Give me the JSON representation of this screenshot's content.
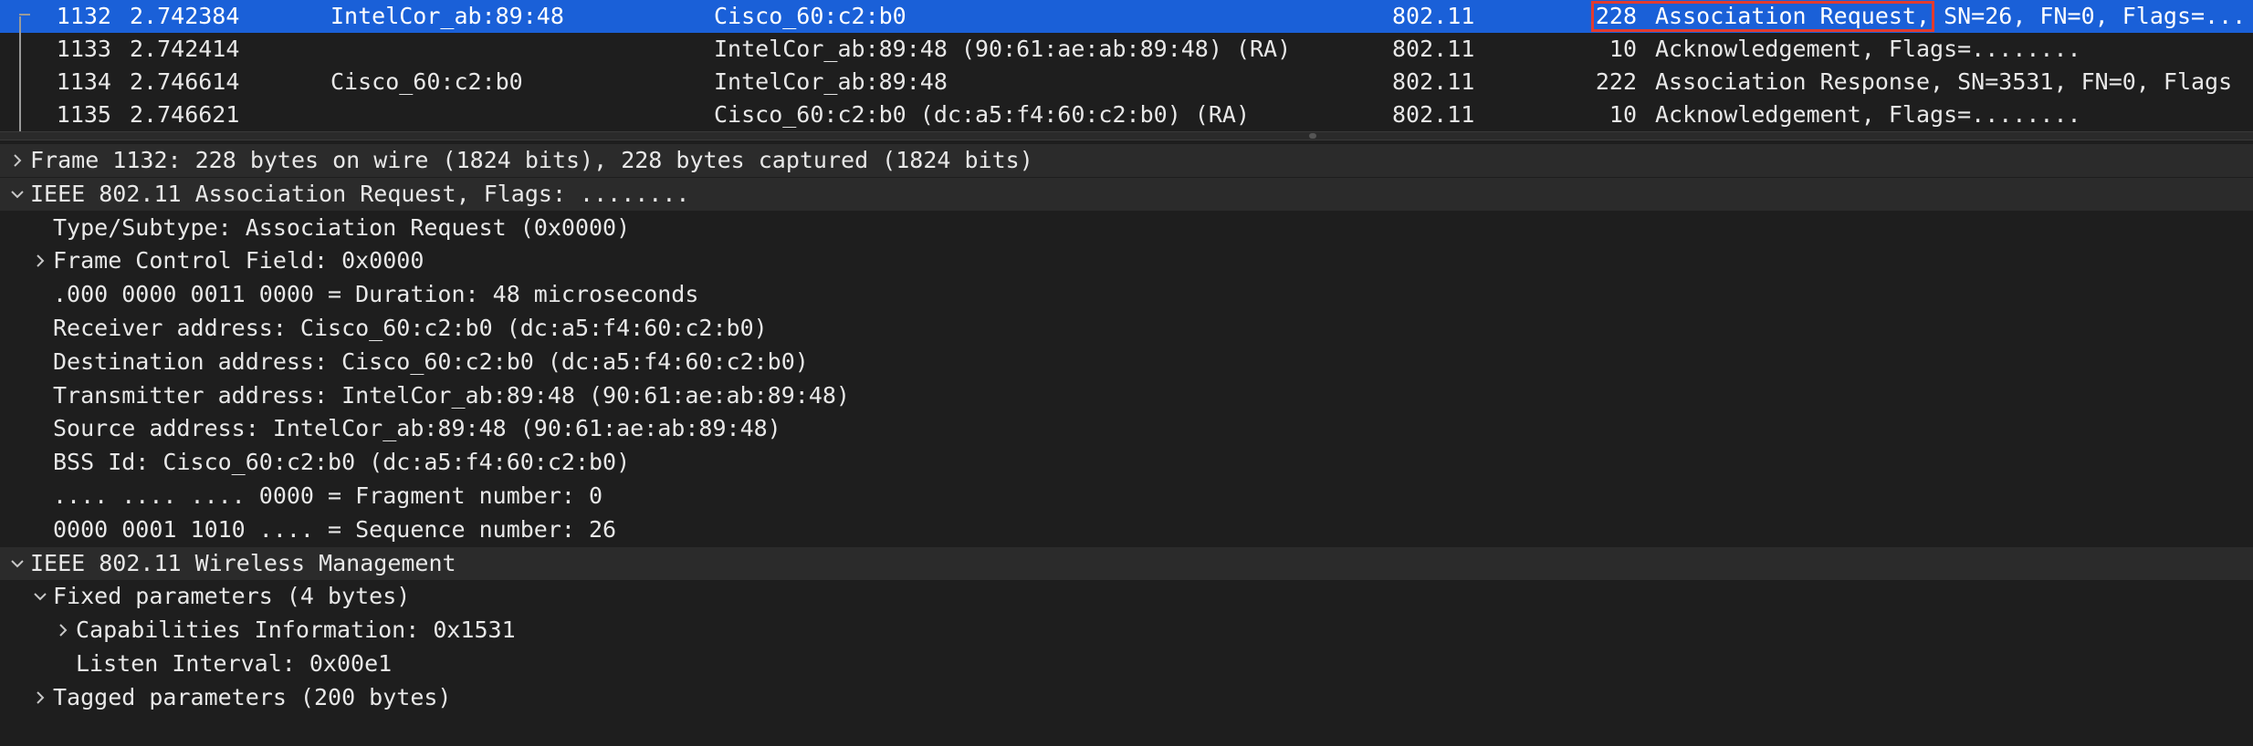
{
  "packet_list": {
    "rows": [
      {
        "no": "1132",
        "time": "2.742384",
        "source": "IntelCor_ab:89:48",
        "destination": "Cisco_60:c2:b0",
        "protocol": "802.11",
        "length": "228",
        "info": "Association Request, SN=26, FN=0, Flags=...",
        "selected": true
      },
      {
        "no": "1133",
        "time": "2.742414",
        "source": "",
        "destination": "IntelCor_ab:89:48 (90:61:ae:ab:89:48) (RA)",
        "protocol": "802.11",
        "length": "10",
        "info": "Acknowledgement, Flags=........",
        "selected": false
      },
      {
        "no": "1134",
        "time": "2.746614",
        "source": "Cisco_60:c2:b0",
        "destination": "IntelCor_ab:89:48",
        "protocol": "802.11",
        "length": "222",
        "info": "Association Response, SN=3531, FN=0, Flags",
        "selected": false
      },
      {
        "no": "1135",
        "time": "2.746621",
        "source": "",
        "destination": "Cisco_60:c2:b0 (dc:a5:f4:60:c2:b0) (RA)",
        "protocol": "802.11",
        "length": "10",
        "info": "Acknowledgement, Flags=........",
        "selected": false
      }
    ]
  },
  "details": {
    "rows": [
      {
        "text": "Frame 1132: 228 bytes on wire (1824 bits), 228 bytes captured (1824 bits)",
        "level": 0,
        "toggle": "collapsed"
      },
      {
        "text": "IEEE 802.11 Association Request, Flags: ........",
        "level": 0,
        "toggle": "expanded"
      },
      {
        "text": "Type/Subtype: Association Request (0x0000)",
        "level": 1,
        "toggle": "none"
      },
      {
        "text": "Frame Control Field: 0x0000",
        "level": 1,
        "toggle": "collapsed"
      },
      {
        "text": ".000 0000 0011 0000 = Duration: 48 microseconds",
        "level": 1,
        "toggle": "none"
      },
      {
        "text": "Receiver address: Cisco_60:c2:b0 (dc:a5:f4:60:c2:b0)",
        "level": 1,
        "toggle": "none"
      },
      {
        "text": "Destination address: Cisco_60:c2:b0 (dc:a5:f4:60:c2:b0)",
        "level": 1,
        "toggle": "none"
      },
      {
        "text": "Transmitter address: IntelCor_ab:89:48 (90:61:ae:ab:89:48)",
        "level": 1,
        "toggle": "none"
      },
      {
        "text": "Source address: IntelCor_ab:89:48 (90:61:ae:ab:89:48)",
        "level": 1,
        "toggle": "none"
      },
      {
        "text": "BSS Id: Cisco_60:c2:b0 (dc:a5:f4:60:c2:b0)",
        "level": 1,
        "toggle": "none"
      },
      {
        "text": ".... .... .... 0000 = Fragment number: 0",
        "level": 1,
        "toggle": "none"
      },
      {
        "text": "0000 0001 1010 .... = Sequence number: 26",
        "level": 1,
        "toggle": "none"
      },
      {
        "text": "IEEE 802.11 Wireless Management",
        "level": 0,
        "toggle": "expanded"
      },
      {
        "text": "Fixed parameters (4 bytes)",
        "level": 1,
        "toggle": "expanded"
      },
      {
        "text": "Capabilities Information: 0x1531",
        "level": 2,
        "toggle": "collapsed"
      },
      {
        "text": "Listen Interval: 0x00e1",
        "level": 2,
        "toggle": "none"
      },
      {
        "text": "Tagged parameters (200 bytes)",
        "level": 1,
        "toggle": "collapsed"
      }
    ]
  },
  "colors": {
    "background": "#1e1e1e",
    "selected_row": "#1a60d8",
    "header_row": "#2b2b2b",
    "highlight_box": "#e23b2f",
    "text": "#e8e8e8"
  },
  "icons": {
    "collapsed": "chevron-right-icon",
    "expanded": "chevron-down-icon"
  }
}
